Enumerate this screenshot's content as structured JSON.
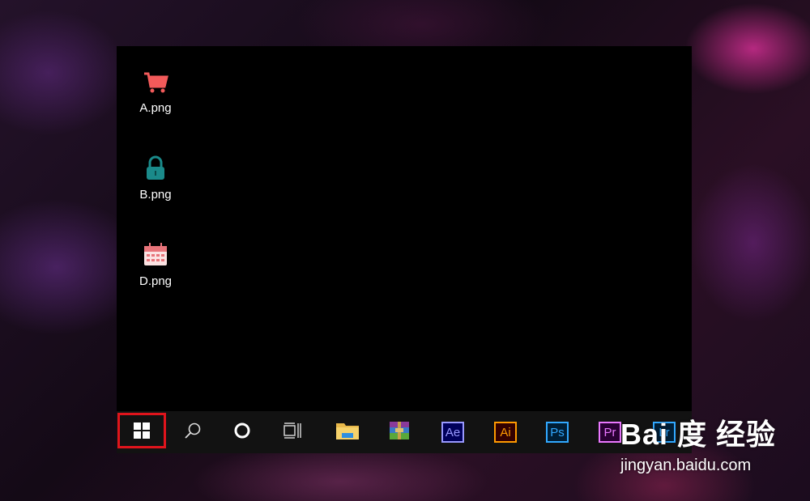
{
  "desktop": {
    "icons": [
      {
        "label": "A.png",
        "icon": "shopping-cart-icon"
      },
      {
        "label": "B.png",
        "icon": "padlock-icon"
      },
      {
        "label": "D.png",
        "icon": "calendar-icon"
      }
    ]
  },
  "taskbar": {
    "items": [
      {
        "name": "start",
        "icon": "windows-logo-icon",
        "highlighted": true
      },
      {
        "name": "search",
        "icon": "search-icon"
      },
      {
        "name": "cortana",
        "icon": "cortana-circle-icon"
      },
      {
        "name": "task-view",
        "icon": "task-view-icon"
      },
      {
        "name": "file-explorer",
        "icon": "folder-icon"
      },
      {
        "name": "winrar",
        "icon": "winrar-icon"
      },
      {
        "name": "after-effects",
        "abbr": "Ae",
        "color": "#9999ff"
      },
      {
        "name": "illustrator",
        "abbr": "Ai",
        "color": "#ff9a00"
      },
      {
        "name": "photoshop",
        "abbr": "Ps",
        "color": "#31a8ff"
      },
      {
        "name": "premiere",
        "abbr": "Pr",
        "color": "#ea77ff"
      },
      {
        "name": "lightroom",
        "abbr": "Lr",
        "color": "#31a8ff"
      }
    ]
  },
  "colors": {
    "highlight_border": "#e0141c",
    "cart": "#f25a5a",
    "lock": "#1a8a8a",
    "calendar": "#f2a0a0"
  },
  "watermark": {
    "logo": "Bai 度 经验",
    "url": "jingyan.baidu.com"
  }
}
